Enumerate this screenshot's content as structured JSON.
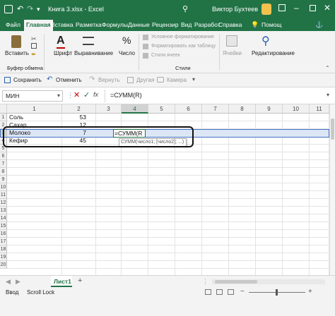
{
  "title_bar": {
    "autosave_icon": "save-icon",
    "undo_icon": "undo-icon",
    "redo_icon": "redo-icon",
    "title": "Книга 3.xlsx  -  Excel",
    "search_icon": "search-icon",
    "user_name": "Виктор Бухтеев"
  },
  "menu_tabs": [
    "Файл",
    "Главная",
    "Вставка",
    "Разметка",
    "Формулы",
    "Данные",
    "Рецензир",
    "Вид",
    "Разработ",
    "Справка"
  ],
  "active_tab": "Главная",
  "help_label": "Помощ",
  "ribbon": {
    "paste_label": "Вставить",
    "font_label": "Шрифт",
    "align_label": "Выравнивание",
    "number_label": "Число",
    "cond_format_label": "Условное форматирование",
    "format_table_label": "Форматировать как таблицу",
    "cell_styles_label": "Стили ячеек",
    "cells_label": "Ячейки",
    "editing_label": "Редактирование",
    "clipboard_group": "Буфер обмена",
    "styles_group": "Стили"
  },
  "quick_access": {
    "save_label": "Сохранить",
    "undo_label": "Отменить",
    "redo_label": "Вернуть",
    "other_label": "Другая",
    "camera_label": "Камера"
  },
  "formula_bar": {
    "name_box": "МИН",
    "fx_label": "fx",
    "formula": "=СУММ(R)"
  },
  "grid": {
    "columns": [
      "1",
      "2",
      "3",
      "4",
      "5",
      "6",
      "7",
      "8",
      "9",
      "10",
      "11"
    ],
    "rows": [
      "1",
      "2",
      "3",
      "4",
      "5",
      "6",
      "7",
      "8",
      "9",
      "10",
      "11",
      "12",
      "13",
      "14",
      "15",
      "16",
      "17",
      "18",
      "19",
      "20"
    ],
    "cells": [
      {
        "row": 1,
        "text": "Соль",
        "value": "53"
      },
      {
        "row": 2,
        "text": "Сахар",
        "value": "12"
      },
      {
        "row": 3,
        "text": "Молоко",
        "value": "7"
      },
      {
        "row": 4,
        "text": "Кефир",
        "value": "45"
      }
    ],
    "editing_cell": "=СУММ(R",
    "tooltip": "СУММ(число1; [число2]; ...)"
  },
  "sheet_tabs": {
    "sheet_name": "Лист1",
    "add_sheet": "+"
  },
  "status_bar": {
    "mode": "Ввод",
    "scroll_lock": "Scroll Lock"
  },
  "colors": {
    "excel_green": "#217346",
    "selection_blue": "#4472c4"
  }
}
